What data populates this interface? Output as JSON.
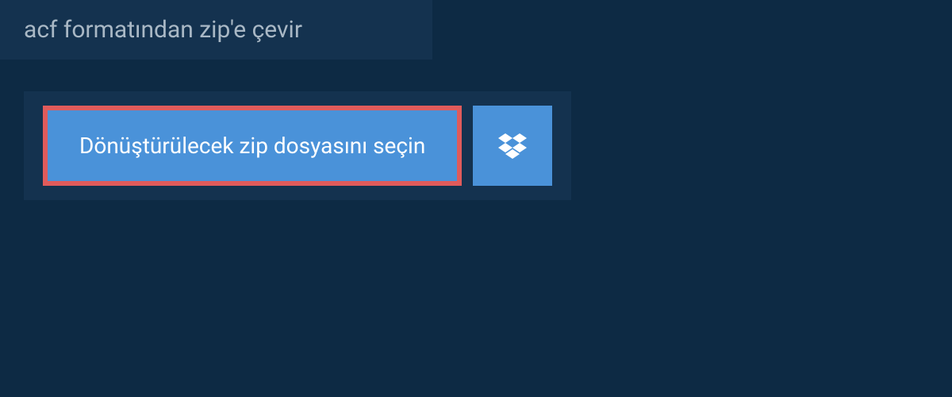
{
  "header": {
    "title": "acf formatından zip'e çevir"
  },
  "buttons": {
    "select_file_label": "Dönüştürülecek zip dosyasını seçin"
  },
  "colors": {
    "background": "#0d2a44",
    "panel": "#14324f",
    "button": "#4a92d9",
    "button_border": "#e05b5b",
    "text_muted": "#a9b8c5",
    "text_light": "#ffffff"
  }
}
